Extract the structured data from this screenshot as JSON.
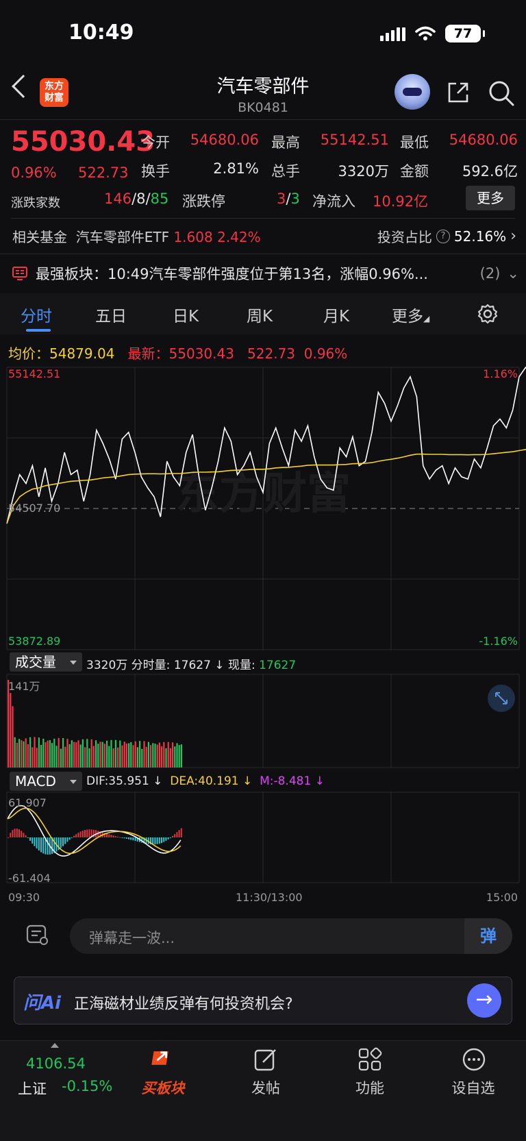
{
  "status": {
    "time": "10:49",
    "battery": "77"
  },
  "header": {
    "logo": "东方\n财富",
    "title": "汽车零部件",
    "code": "BK0481"
  },
  "quote": {
    "price": "55030.43",
    "change_pct": "0.96%",
    "change": "522.73",
    "open_label": "今开",
    "open": "54680.06",
    "high_label": "最高",
    "high": "55142.51",
    "low_label": "最低",
    "low": "54680.06",
    "turnover_label": "换手",
    "turnover": "2.81%",
    "volume_label": "总手",
    "volume": "3320万",
    "amount_label": "金额",
    "amount": "592.6亿",
    "breadth_label": "涨跌家数",
    "breadth_up": "146",
    "breadth_flat": "8",
    "breadth_down": "85",
    "limit_label": "涨跌停",
    "limit_up": "3",
    "limit_down": "3",
    "netflow_label": "净流入",
    "netflow": "10.92亿",
    "more_label": "更多"
  },
  "fund": {
    "label": "相关基金",
    "name": "汽车零部件ETF",
    "price": "1.608",
    "pct": "2.42%",
    "ratio_label": "投资占比",
    "ratio": "52.16%"
  },
  "strong": {
    "text": "最强板块：10:49汽车零部件强度位于第13名，涨幅0.96%...",
    "count": "(2)"
  },
  "tabs": [
    "分时",
    "五日",
    "日K",
    "周K",
    "月K",
    "更多"
  ],
  "chart_info": {
    "avg_label": "均价：",
    "avg": "54879.04",
    "last_label": "最新：",
    "last": "55030.43",
    "chg": "522.73",
    "pct": "0.96%"
  },
  "axis": {
    "top": "55142.51",
    "top_pct": "1.16%",
    "mid": "54507.70",
    "bottom": "53872.89",
    "bottom_pct": "-1.16%",
    "vol_max": "141万",
    "macd_max": "61.907",
    "macd_min": "-61.404",
    "t0": "09:30",
    "t1": "11:30/13:00",
    "t2": "15:00"
  },
  "vol": {
    "label": "成交量",
    "total": "3320万",
    "tick_label": "分时量:",
    "tick": "17627",
    "now_label": "现量:",
    "now": "17627"
  },
  "macd": {
    "label": "MACD",
    "dif": "DIF:35.951 ↓",
    "dea": "DEA:40.191 ↓",
    "m": "M:-8.481 ↓"
  },
  "watermark": "东方财富",
  "comment": {
    "placeholder": "弹幕走一波...",
    "danmu": "弹"
  },
  "ai": {
    "logo": "问Ai",
    "text": "正海磁材业绩反弹有何投资机会?"
  },
  "nav": {
    "index_val": "4106.54",
    "index_name": "上证",
    "index_chg": "-0.15%",
    "buy": "买板块",
    "post": "发帖",
    "func": "功能",
    "watch": "设自选"
  },
  "colors": {
    "up": "#f23645",
    "down": "#22c55e",
    "accent": "#4a8ff7",
    "avg": "#f5d130"
  },
  "chart_data": {
    "type": "line",
    "title": "",
    "xlabel": "",
    "ylabel": "",
    "ylim": [
      53872.89,
      55142.51
    ],
    "series": [
      {
        "name": "最新",
        "values": [
          54440,
          54560,
          54660,
          54620,
          54700,
          54560,
          54690,
          54540,
          54620,
          54760,
          54660,
          54680,
          54540,
          54660,
          54860,
          54800,
          54730,
          54640,
          54820,
          54850,
          54760,
          54650,
          54600,
          54560,
          54470,
          54720,
          54650,
          54610,
          54760,
          54840,
          54650,
          54500,
          54600,
          54720,
          54870,
          54810,
          54660,
          54700,
          54760,
          54650,
          54580,
          54800,
          54870,
          54780,
          54700,
          54860,
          54810,
          54880,
          54740,
          54640,
          54600,
          54590,
          54780,
          54740,
          54830,
          54700,
          54720,
          54850,
          55030,
          54980,
          54900,
          54970,
          55050,
          55100,
          55010,
          54700,
          54640,
          54680,
          54700,
          54620,
          54690,
          54650,
          54640,
          54730,
          54690,
          54780,
          54880,
          54910,
          54870,
          54950,
          55100,
          55142,
          55110,
          55060,
          55040,
          55010,
          55030
        ]
      },
      {
        "name": "均价",
        "values": [
          54440,
          54520,
          54560,
          54580,
          54595,
          54600,
          54610,
          54615,
          54620,
          54625,
          54630,
          54632,
          54634,
          54636,
          54640,
          54645,
          54648,
          54650,
          54655,
          54660,
          54662,
          54663,
          54664,
          54664,
          54663,
          54664,
          54665,
          54665,
          54667,
          54670,
          54671,
          54671,
          54672,
          54673,
          54676,
          54679,
          54680,
          54681,
          54683,
          54684,
          54684,
          54686,
          54690,
          54692,
          54693,
          54696,
          54698,
          54702,
          54703,
          54703,
          54703,
          54703,
          54705,
          54706,
          54709,
          54710,
          54711,
          54714,
          54720,
          54725,
          54729,
          54734,
          54740,
          54747,
          54752,
          54752,
          54751,
          54751,
          54751,
          54750,
          54750,
          54750,
          54749,
          54750,
          54750,
          54751,
          54754,
          54757,
          54760,
          54763,
          54768,
          54773,
          54778,
          54782,
          54785,
          54788,
          54791
        ]
      }
    ]
  }
}
